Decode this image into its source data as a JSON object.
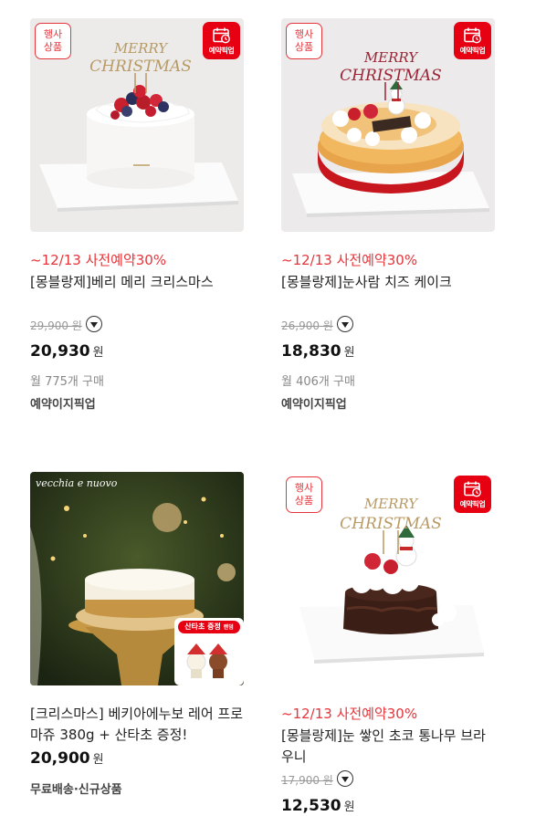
{
  "products": [
    {
      "event_badge": [
        "행사",
        "상품"
      ],
      "pickup_badge": "예약픽업",
      "topper": [
        "MERRY",
        "CHRISTMAS"
      ],
      "promo": "~12/13 사전예약30%",
      "name": "[몽블랑제]베리 메리 크리스마스",
      "original_price": "29,900 원",
      "price": "20,930",
      "currency": "원",
      "sold": "월 775개 구매",
      "tag": "예약이지픽업"
    },
    {
      "event_badge": [
        "행사",
        "상품"
      ],
      "pickup_badge": "예약픽업",
      "topper": [
        "MERRY",
        "CHRISTMAS"
      ],
      "promo": "~12/13 사전예약30%",
      "name": "[몽블랑제]눈사람 치즈 케이크",
      "original_price": "26,900 원",
      "price": "18,830",
      "currency": "원",
      "sold": "월 406개 구매",
      "tag": "예약이지픽업"
    },
    {
      "brand_watermark": "vecchia e nuovo",
      "gift_label": "산타초 증정",
      "gift_sub": "랜덤",
      "name": "[크리스마스] 베키아에누보 레어 프로마쥬 380g + 산타초 증정!",
      "price": "20,900",
      "currency": "원",
      "tag": "무료배송·신규상품"
    },
    {
      "event_badge": [
        "행사",
        "상품"
      ],
      "pickup_badge": "예약픽업",
      "topper": [
        "MERRY",
        "CHRISTMAS"
      ],
      "promo": "~12/13 사전예약30%",
      "name": "[몽블랑제]눈 쌓인 초코 통나무 브라우니",
      "original_price": "17,900 원",
      "price": "12,530",
      "currency": "원"
    }
  ]
}
